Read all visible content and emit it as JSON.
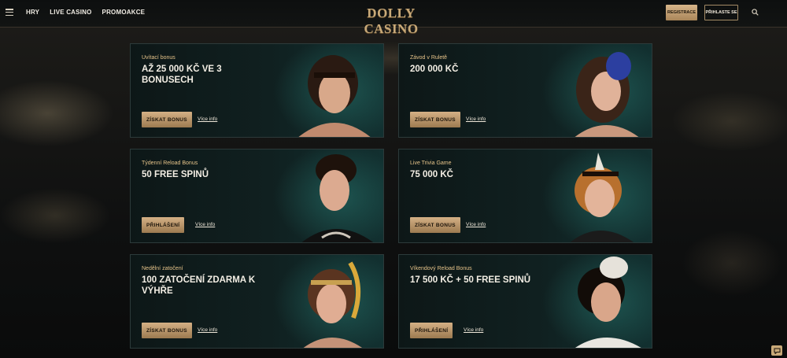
{
  "header": {
    "nav": [
      "HRY",
      "LIVE CASINO",
      "PROMOAKCE"
    ],
    "logo": "DOLLY CASINO",
    "register_label": "REGISTRACE",
    "login_label": "PŘIHLASTE SE"
  },
  "promos": [
    {
      "subtitle": "Uvítací bonus",
      "title": "AŽ 25 000 KČ VE 3 BONUSECH",
      "cta": "ZÍSKAT BONUS",
      "more": "Více info"
    },
    {
      "subtitle": "Závod v Ruletě",
      "title": "200 000 KČ",
      "cta": "ZÍSKAT BONUS",
      "more": "Více info"
    },
    {
      "subtitle": "Týdenní Reload Bonus",
      "title": "50 FREE SPINŮ",
      "cta": "PŘIHLÁŠENÍ",
      "more": "Více info"
    },
    {
      "subtitle": "Live Trivia Game",
      "title": "75 000 KČ",
      "cta": "ZÍSKAT BONUS",
      "more": "Více info"
    },
    {
      "subtitle": "Nedělní zatočení",
      "title": "100 ZATOČENÍ ZDARMA K VÝHŘE",
      "cta": "ZÍSKAT BONUS",
      "more": "Více info"
    },
    {
      "subtitle": "Víkendový Reload Bonus",
      "title": "17 500 KČ + 50 FREE SPINŮ",
      "cta": "PŘIHLÁŠENÍ",
      "more": "Více info"
    }
  ],
  "colors": {
    "gold": "#c8a978",
    "teal": "#123030"
  },
  "icons": {
    "menu": "hamburger-icon",
    "search": "search-icon",
    "chat": "chat-icon"
  }
}
